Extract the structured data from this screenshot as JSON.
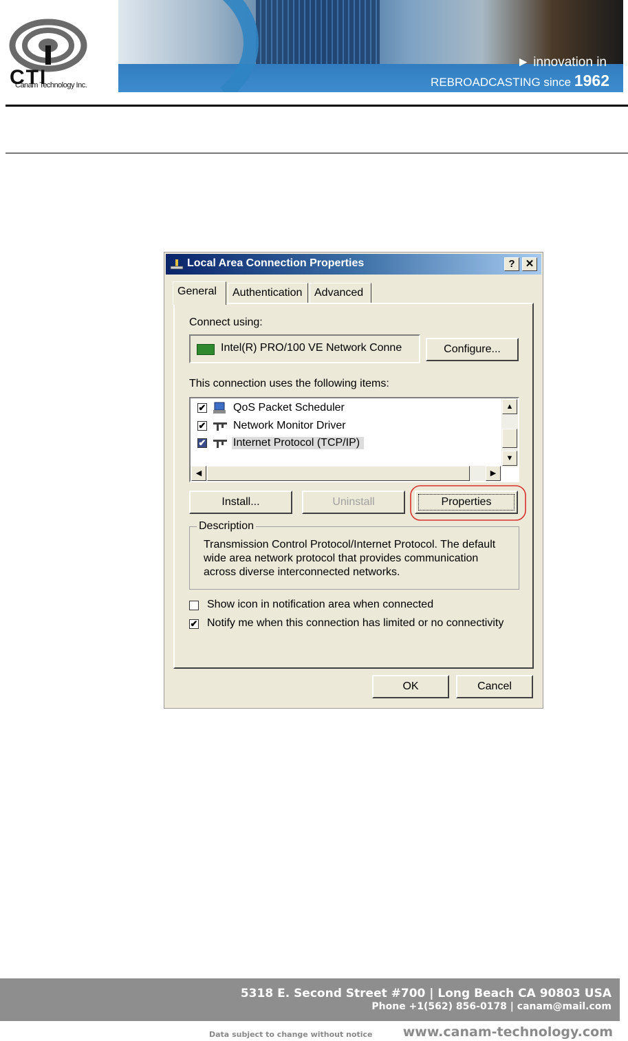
{
  "header": {
    "logo_text": "CTI",
    "logo_subtitle": "Canam Technology Inc.",
    "banner_innovation": "► innovation in",
    "banner_tagline_prefix": "REBROADCASTING since",
    "banner_year": "1962"
  },
  "dialog": {
    "title": "Local Area Connection Properties",
    "help_button": "?",
    "close_button": "✕",
    "tabs": [
      "General",
      "Authentication",
      "Advanced"
    ],
    "active_tab": "General",
    "connect_using_label": "Connect using:",
    "adapter_name": "Intel(R) PRO/100 VE Network Conne",
    "configure_button": "Configure...",
    "items_label": "This connection uses the following items:",
    "items": [
      {
        "label": "QoS Packet Scheduler",
        "checked": true,
        "icon": "scheduler-icon"
      },
      {
        "label": "Network Monitor Driver",
        "checked": true,
        "icon": "network-protocol-icon"
      },
      {
        "label": "Internet Protocol (TCP/IP)",
        "checked": true,
        "selected": true,
        "icon": "network-protocol-icon"
      }
    ],
    "install_button": "Install...",
    "uninstall_button": "Uninstall",
    "properties_button": "Properties",
    "properties_highlight_color": "#d9302c",
    "description_label": "Description",
    "description_text": "Transmission Control Protocol/Internet Protocol. The default wide area network protocol that provides communication across diverse interconnected networks.",
    "show_icon_label": "Show icon in notification area when connected",
    "show_icon_checked": false,
    "notify_label": "Notify me when this connection has limited or no connectivity",
    "notify_checked": true,
    "ok_button": "OK",
    "cancel_button": "Cancel"
  },
  "footer": {
    "address_line": "5318 E. Second Street  #700 | Long Beach CA 90803 USA",
    "contact_line": "Phone +1(562) 856-0178 | canam@mail.com",
    "notice": "Data subject to change without notice",
    "website": "www.canam-technology.com"
  }
}
